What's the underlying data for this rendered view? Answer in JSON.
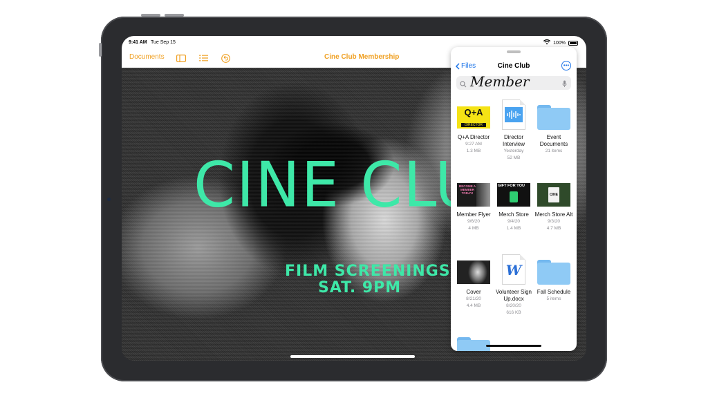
{
  "status_bar": {
    "time": "9:41 AM",
    "date": "Tue Sep 15",
    "battery": "100%",
    "battery_level": 1.0
  },
  "toolbar": {
    "documents_label": "Documents",
    "document_title": "Cine Club Membership"
  },
  "poster": {
    "headline": "CINE CLUB",
    "line1": "FILM SCREENINGS",
    "line2": "SAT. 9PM",
    "accent_color": "#3ee8a8"
  },
  "files_panel": {
    "back_label": "Files",
    "title": "Cine Club",
    "search_query": "Member",
    "items": [
      {
        "name": "Q+A Director",
        "meta1": "9:27 AM",
        "meta2": "1.3 MB",
        "thumb_text": "Q+A",
        "thumb_subtext": "DIRECTOR",
        "icon": "image-thumbnail"
      },
      {
        "name": "Director Interview",
        "meta1": "Yesterday",
        "meta2": "52 MB",
        "icon": "audio-file-icon"
      },
      {
        "name": "Event Documents",
        "meta1": "21 items",
        "meta2": "",
        "icon": "folder-icon"
      },
      {
        "name": "Member Flyer",
        "meta1": "9/6/20",
        "meta2": "4 MB",
        "thumb_text": "BECOME A MEMBER TODAY!",
        "icon": "image-thumbnail"
      },
      {
        "name": "Merch Store",
        "meta1": "9/4/20",
        "meta2": "1.4 MB",
        "thumb_text": "GIFT FOR YOU",
        "icon": "image-thumbnail"
      },
      {
        "name": "Merch Store Alt",
        "meta1": "9/3/20",
        "meta2": "4.7 MB",
        "thumb_text": "CINE",
        "icon": "image-thumbnail"
      },
      {
        "name": "Cover",
        "meta1": "8/21/20",
        "meta2": "4.4 MB",
        "icon": "image-thumbnail"
      },
      {
        "name": "Volunteer Sign Up.docx",
        "meta1": "8/20/20",
        "meta2": "616 KB",
        "thumb_text": "W",
        "icon": "word-document-icon"
      },
      {
        "name": "Fall Schedule",
        "meta1": "5 items",
        "meta2": "",
        "icon": "folder-icon"
      }
    ]
  }
}
